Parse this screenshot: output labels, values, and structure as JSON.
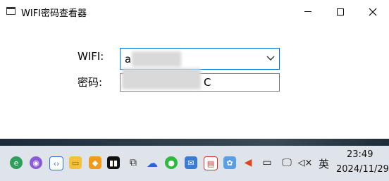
{
  "window": {
    "title": "WIFI密码查看器",
    "icon": "app-window-icon",
    "controls": [
      "minimize-icon",
      "maximize-icon",
      "close-icon"
    ]
  },
  "form": {
    "wifi_label": "WIFI:",
    "wifi_value": "a",
    "password_label": "密码:",
    "password_value": "C"
  },
  "colors": {
    "focus_border": "#0078d7",
    "taskbar": "#dfe4ea"
  },
  "taskbar": {
    "apps": [
      "edge-icon",
      "cat-icon",
      "code-icon",
      "file-explorer-icon",
      "shield-icon",
      "dual-window-icon",
      "copy-icon",
      "cloud-icon",
      "wechat-icon",
      "mail-icon",
      "app-icon",
      "photos-icon"
    ],
    "tray": {
      "ime": "英",
      "time": "23:49",
      "date": "2024/11/29"
    }
  }
}
